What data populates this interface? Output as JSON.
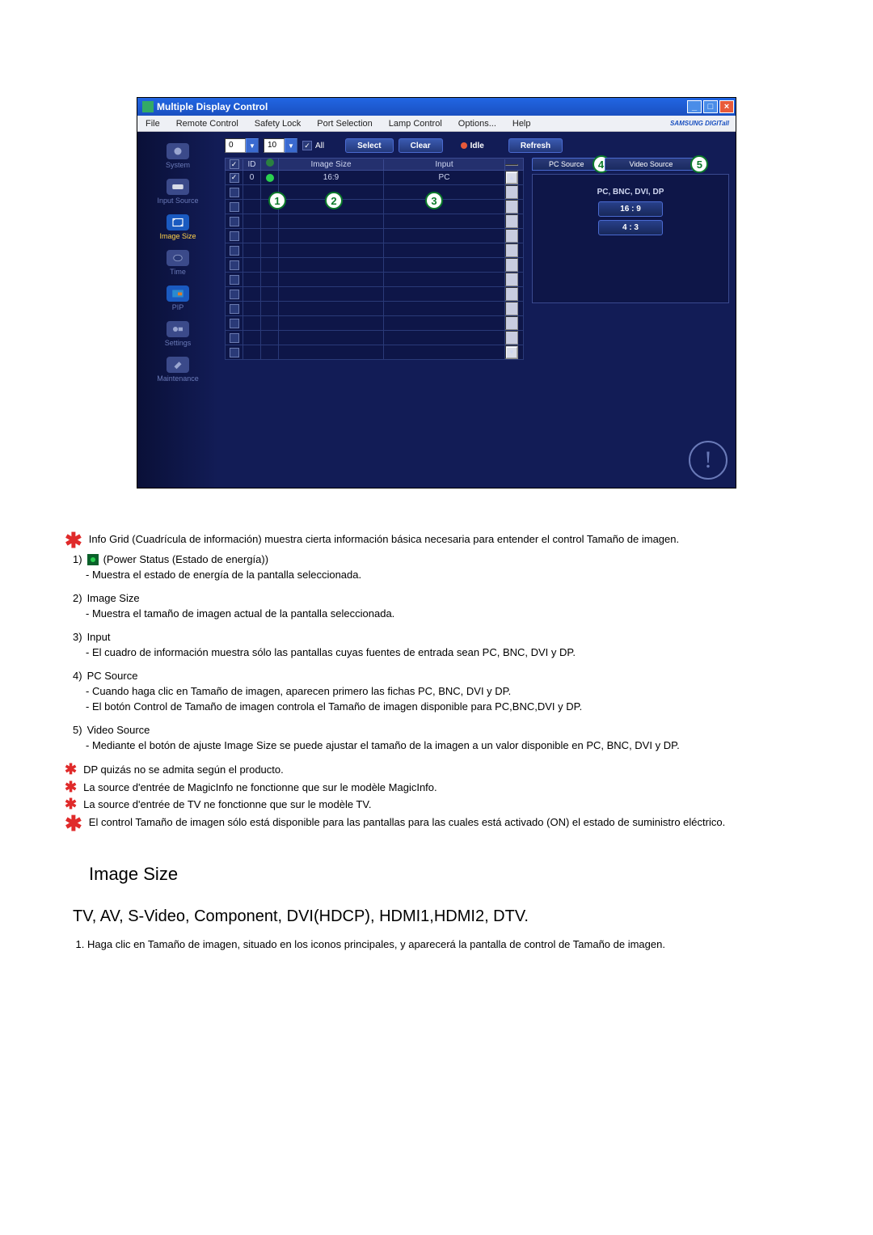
{
  "window": {
    "title": "Multiple Display Control",
    "brand": "SAMSUNG DIGITall"
  },
  "menu": [
    "File",
    "Remote Control",
    "Safety Lock",
    "Port Selection",
    "Lamp Control",
    "Options...",
    "Help"
  ],
  "sidebar": [
    {
      "label": "System"
    },
    {
      "label": "Input Source"
    },
    {
      "label": "Image Size"
    },
    {
      "label": "Time"
    },
    {
      "label": "PIP"
    },
    {
      "label": "Settings"
    },
    {
      "label": "Maintenance"
    }
  ],
  "toolbar": {
    "combo1": "0",
    "combo2": "10",
    "all_label": "All",
    "select": "Select",
    "clear": "Clear",
    "idle": "Idle",
    "refresh": "Refresh"
  },
  "grid": {
    "headers": {
      "id": "ID",
      "imagesize": "Image Size",
      "input": "Input"
    },
    "row0": {
      "id": "0",
      "imagesize": "16:9",
      "input": "PC"
    }
  },
  "rpanel": {
    "tab_pc": "PC Source",
    "tab_video": "Video Source",
    "src_label": "PC, BNC, DVI, DP",
    "ratio1": "16 : 9",
    "ratio2": "4 : 3"
  },
  "callouts": {
    "c1": "1",
    "c2": "2",
    "c3": "3",
    "c4": "4",
    "c5": "5"
  },
  "doc": {
    "star1": "Info Grid (Cuadrícula de información) muestra cierta información básica necesaria para entender el control Tamaño de imagen.",
    "n1_head": "(Power Status (Estado de energía))",
    "n1_sub": "- Muestra el estado de energía de la pantalla seleccionada.",
    "n2_head": "Image Size",
    "n2_sub": "- Muestra el tamaño de imagen actual de la pantalla seleccionada.",
    "n3_head": "Input",
    "n3_sub": "- El cuadro de información muestra sólo las pantallas cuyas fuentes de entrada sean PC, BNC, DVI y DP.",
    "n4_head": "PC Source",
    "n4_sub1": "- Cuando haga clic en Tamaño de imagen, aparecen primero las fichas PC, BNC, DVI y DP.",
    "n4_sub2": "- El botón Control de Tamaño de imagen controla el Tamaño de imagen disponible para PC,BNC,DVI y DP.",
    "n5_head": "Video Source",
    "n5_sub": "- Mediante el botón de ajuste Image Size se puede ajustar el tamaño de la imagen a un valor disponible en PC, BNC, DVI y DP.",
    "star2": "DP quizás no se admita según el producto.",
    "star3": "La source d'entrée de MagicInfo ne fonctionne que sur le modèle MagicInfo.",
    "star4": "La source d'entrée de TV ne fonctionne que sur le modèle TV.",
    "star5": "El control Tamaño de imagen sólo está disponible para las pantallas para las cuales está activado (ON) el estado de suministro eléctrico.",
    "h2": "Image Size",
    "h3": "TV, AV, S-Video, Component, DVI(HDCP), HDMI1,HDMI2, DTV.",
    "ol1": "Haga clic en Tamaño de imagen, situado en los iconos principales, y aparecerá la pantalla de control de Tamaño de imagen."
  }
}
